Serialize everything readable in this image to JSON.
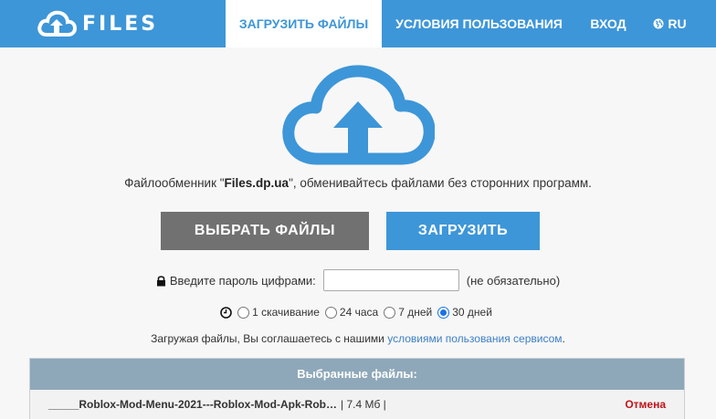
{
  "brand": {
    "name": "FILES",
    "icon": "cloud-upload-icon"
  },
  "nav": {
    "upload": "ЗАГРУЗИТЬ ФАЙЛЫ",
    "terms": "УСЛОВИЯ ПОЛЬЗОВАНИЯ",
    "login": "ВХОД",
    "lang": "RU"
  },
  "tagline": {
    "before": "Файлообменник \"",
    "site": "Files.dp.ua",
    "after": "\", обменивайтесь файлами без сторонних программ."
  },
  "buttons": {
    "select": "ВЫБРАТЬ ФАЙЛЫ",
    "upload": "ЗАГРУЗИТЬ"
  },
  "password": {
    "label": "Введите пароль цифрами:",
    "value": "",
    "note": "(не обязательно)"
  },
  "retention": {
    "options": [
      "1 скачивание",
      "24 часа",
      "7 дней",
      "30 дней"
    ],
    "selected": "30 дней"
  },
  "agreement": {
    "before": "Загружая файлы, Вы соглашаетесь с нашими ",
    "link": "условиями пользования сервисом",
    "after": "."
  },
  "files": {
    "header": "Выбранные файлы:",
    "items": [
      {
        "name": "_____Roblox-Mod-Menu-2021---Roblox-Mod-Apk-Rob…",
        "size": "| 7.4 Мб |",
        "cancel": "Отмена"
      }
    ]
  },
  "colors": {
    "accent": "#3d96d8",
    "select_button": "#717171",
    "cancel": "#c0141b",
    "panel_header": "#8ea8b9"
  }
}
